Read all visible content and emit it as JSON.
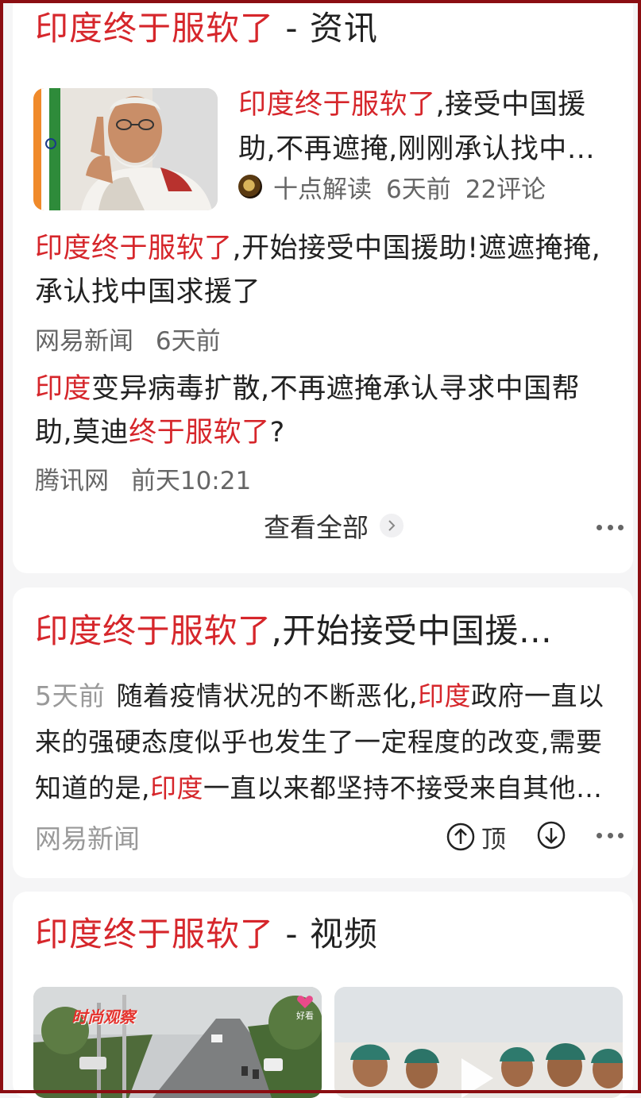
{
  "news_card": {
    "title_highlight": "印度终于服软了",
    "title_suffix": " - 资讯",
    "item1": {
      "title_highlight": "印度终于服软了",
      "title_rest": ",接受中国援助,不再遮掩,刚刚承认找中…",
      "author": "十点解读",
      "time": "6天前",
      "comments": "22评论"
    },
    "item2": {
      "title_highlight": "印度终于服软了",
      "title_rest": ",开始接受中国援助!遮遮掩掩,承认找中国求援了",
      "source": "网易新闻",
      "time": "6天前"
    },
    "item3": {
      "title_highlight1": "印度",
      "title_middle": "变异病毒扩散,不再遮掩承认寻求中国帮助,莫迪",
      "title_highlight2": "终于服软了",
      "title_end": "?",
      "source": "腾讯网",
      "time": "前天10:21"
    },
    "view_all": "查看全部"
  },
  "article_card": {
    "title_highlight": "印度终于服软了",
    "title_rest": ",开始接受中国援…",
    "time": "5天前",
    "body_seg1": "随着疫情状况的不断恶化,",
    "body_hl1": "印度",
    "body_seg2": "政府一直以来的强硬态度似乎也发生了一定程度的改变,需要知道的是,",
    "body_hl2": "印度",
    "body_seg3": "一直以来都坚持不接受来自其他…",
    "source": "网易新闻",
    "up_label": "顶"
  },
  "video_card": {
    "title_highlight": "印度终于服软了",
    "title_suffix": " - 视频",
    "video1_logo": "时尚观察",
    "video1_badge": "好看"
  },
  "colors": {
    "highlight": "#d6262b",
    "background": "#f5f5f6",
    "frame": "#8b0e12",
    "accent": "#4e6ef2"
  }
}
